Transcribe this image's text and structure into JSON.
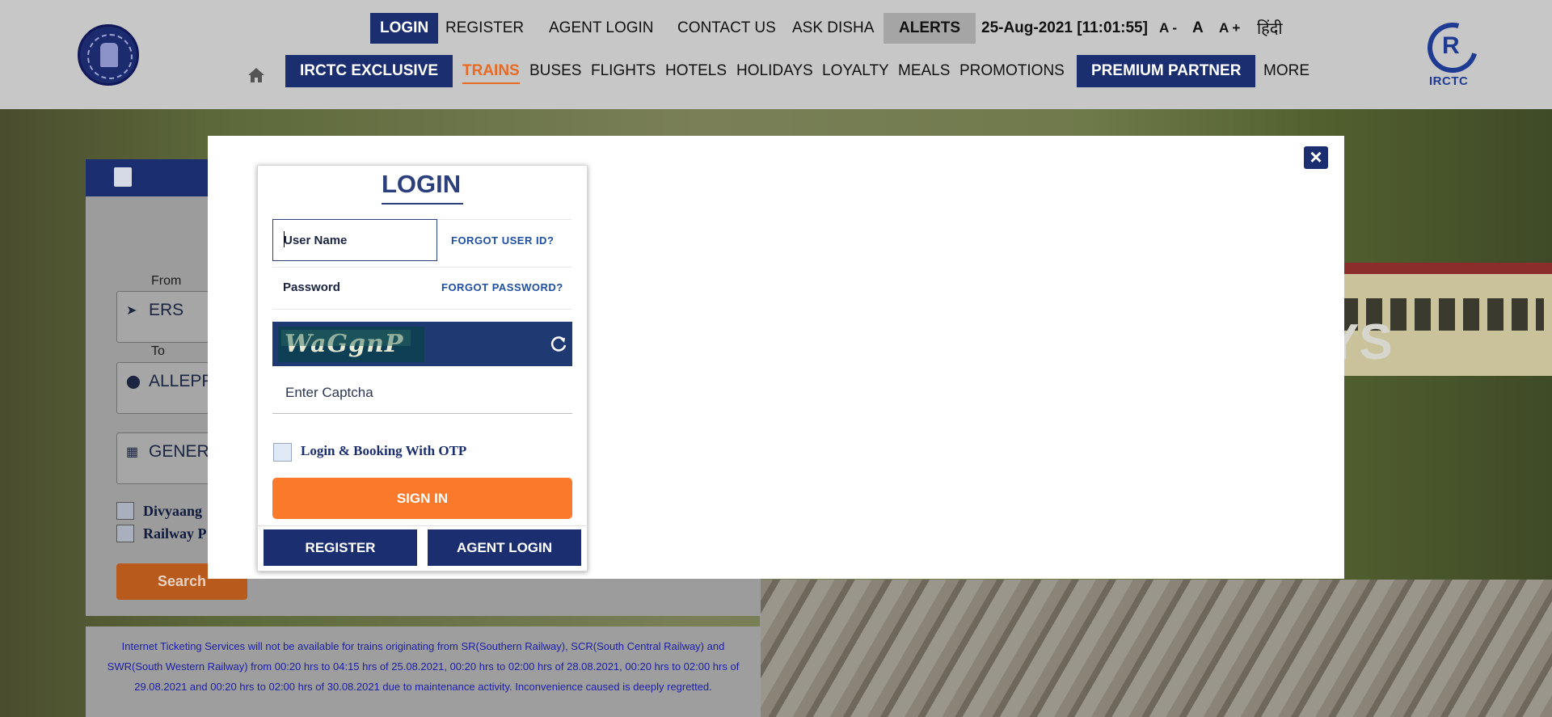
{
  "header": {
    "top_nav": {
      "login": "LOGIN",
      "register": "REGISTER",
      "agent_login": "AGENT LOGIN",
      "contact_us": "CONTACT US",
      "ask_disha": "ASK DISHA",
      "alerts": "ALERTS",
      "datetime": "25-Aug-2021 [11:01:55]",
      "font_decrease": "A -",
      "font_normal": "A",
      "font_increase": "A +",
      "hindi": "हिंदी"
    },
    "main_nav": {
      "irctc_exclusive": "IRCTC EXCLUSIVE",
      "trains": "TRAINS",
      "buses": "BUSES",
      "flights": "FLIGHTS",
      "hotels": "HOTELS",
      "holidays": "HOLIDAYS",
      "loyalty": "LOYALTY",
      "meals": "MEALS",
      "promotions": "PROMOTIONS",
      "premium_partner": "PREMIUM PARTNER",
      "more": "MORE"
    },
    "logo_text": "IRCTC"
  },
  "booking": {
    "from_label": "From",
    "from_value": "ERS",
    "to_label": "To",
    "to_value": "ALLEPP",
    "quota_value": "GENERA",
    "divyaang_label": "Divyaang",
    "railway_pass_label": "Railway P",
    "search_label": "Search",
    "hero_text": "YS"
  },
  "notice": "Internet Ticketing Services will not be available for trains originating from SR(Southern Railway), SCR(South Central Railway) and SWR(South Western Railway) from 00:20 hrs to 04:15 hrs of 25.08.2021, 00:20 hrs to 02:00 hrs of 28.08.2021, 00:20 hrs to 02:00 hrs of 29.08.2021 and 00:20 hrs to 02:00 hrs of 30.08.2021 due to maintenance activity. Inconvenience caused is deeply regretted.",
  "login_modal": {
    "title": "LOGIN",
    "username_placeholder": "User Name",
    "forgot_user_id": "FORGOT USER ID?",
    "password_placeholder": "Password",
    "forgot_password": "FORGOT PASSWORD?",
    "captcha_image_text": "WaGgnP",
    "captcha_placeholder": "Enter Captcha",
    "otp_label": "Login & Booking With OTP",
    "sign_in": "SIGN IN",
    "register": "REGISTER",
    "agent_login": "AGENT LOGIN",
    "close_icon": "close-icon"
  },
  "colors": {
    "navy": "#1b2e6f",
    "orange": "#fb792b",
    "link_blue": "#1e4fa2"
  }
}
